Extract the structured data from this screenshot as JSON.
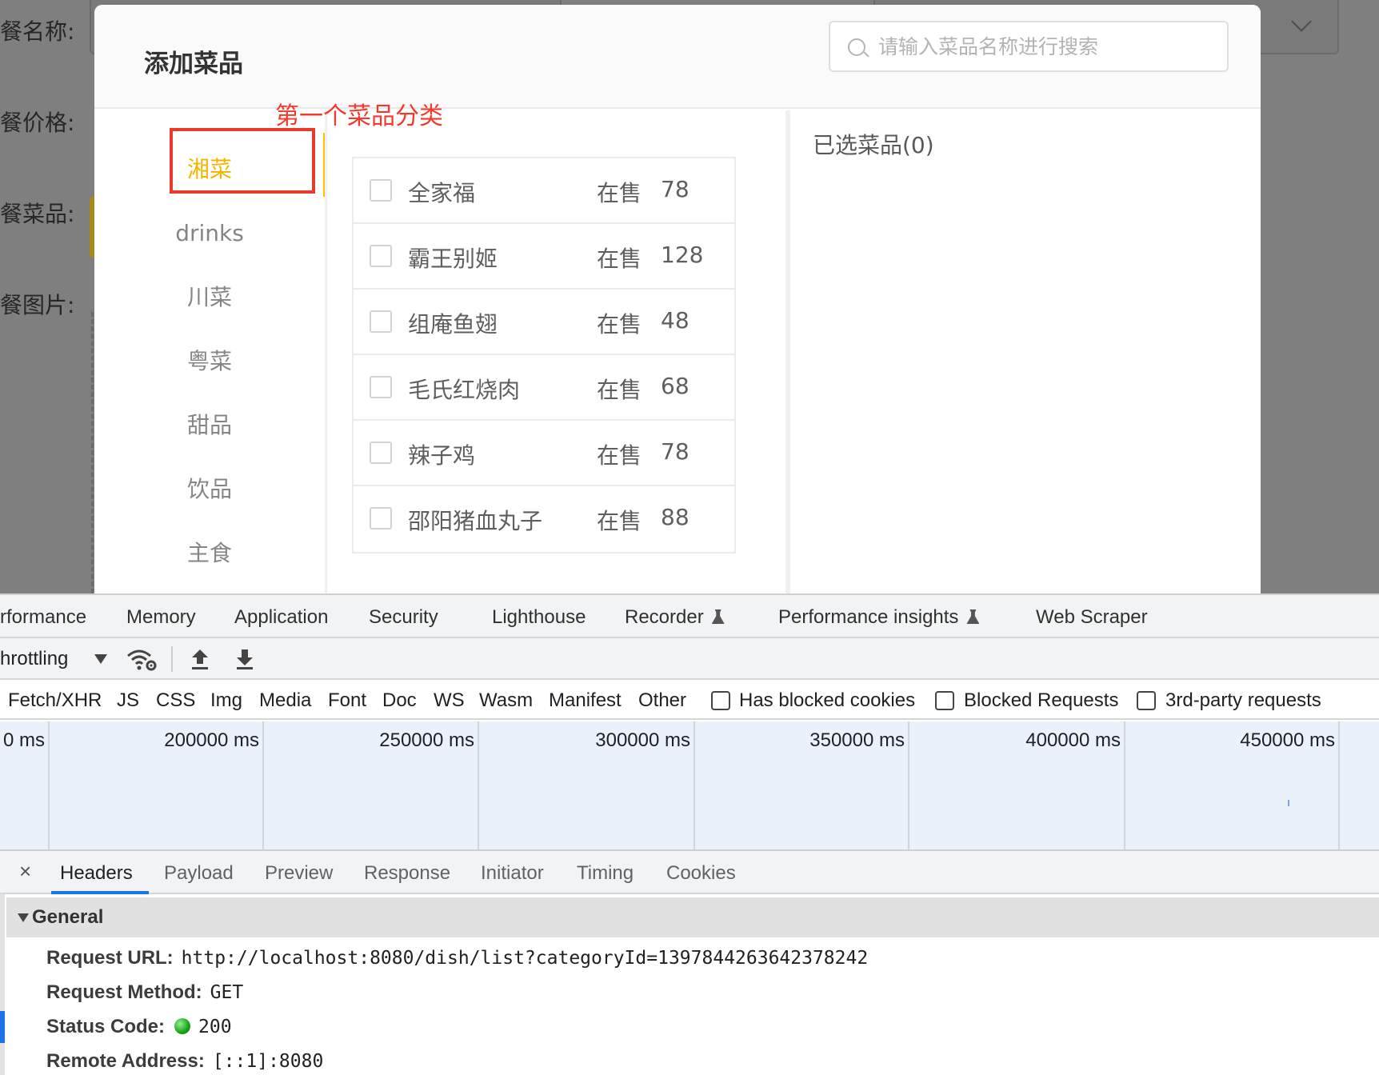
{
  "app": {
    "form_labels": [
      "餐名称:",
      "餐价格:",
      "餐菜品:",
      "餐图片:"
    ]
  },
  "dialog": {
    "title": "添加菜品",
    "search_placeholder": "请输入菜品名称进行搜索",
    "annotation": "第一个菜品分类",
    "categories": [
      "湘菜",
      "drinks",
      "川菜",
      "粤菜",
      "甜品",
      "饮品",
      "主食"
    ],
    "active_category": "湘菜",
    "dishes": [
      {
        "name": "全家福",
        "status": "在售",
        "price": "78"
      },
      {
        "name": "霸王别姬",
        "status": "在售",
        "price": "128"
      },
      {
        "name": "组庵鱼翅",
        "status": "在售",
        "price": "48"
      },
      {
        "name": "毛氏红烧肉",
        "status": "在售",
        "price": "68"
      },
      {
        "name": "辣子鸡",
        "status": "在售",
        "price": "78"
      },
      {
        "name": "邵阳猪血丸子",
        "status": "在售",
        "price": "88"
      }
    ],
    "selected_title": "已选菜品(0)"
  },
  "devtools": {
    "panel_tabs": [
      "rformance",
      "Memory",
      "Application",
      "Security",
      "Lighthouse",
      "Recorder",
      "Performance insights",
      "Web Scraper"
    ],
    "throttling_label": "hrottling",
    "filter_types": [
      "Fetch/XHR",
      "JS",
      "CSS",
      "Img",
      "Media",
      "Font",
      "Doc",
      "WS",
      "Wasm",
      "Manifest",
      "Other"
    ],
    "filter_checkboxes": [
      "Has blocked cookies",
      "Blocked Requests",
      "3rd-party requests"
    ],
    "timeline_ticks": [
      "0 ms",
      "200000 ms",
      "250000 ms",
      "300000 ms",
      "350000 ms",
      "400000 ms",
      "450000 ms"
    ],
    "detail_tabs": [
      "Headers",
      "Payload",
      "Preview",
      "Response",
      "Initiator",
      "Timing",
      "Cookies"
    ],
    "active_detail_tab": "Headers",
    "close_glyph": "×",
    "general_title": "General",
    "general": [
      {
        "key": "Request URL:",
        "value": "http://localhost:8080/dish/list?categoryId=1397844263642378242"
      },
      {
        "key": "Request Method:",
        "value": "GET"
      },
      {
        "key": "Status Code:",
        "value": "200"
      },
      {
        "key": "Remote Address:",
        "value": "[::1]:8080"
      }
    ],
    "colors": {
      "accent_blue": "#1a73e8",
      "status_green": "#16a316",
      "category_active": "#f5b400",
      "annotation_red": "#e83b2c"
    }
  }
}
